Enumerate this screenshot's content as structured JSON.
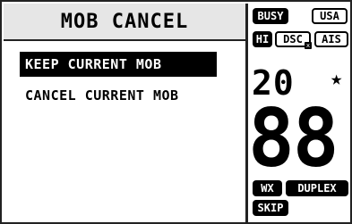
{
  "title": "MOB CANCEL",
  "menu": {
    "items": [
      {
        "label": "KEEP CURRENT MOB",
        "selected": true
      },
      {
        "label": "CANCEL CURRENT MOB",
        "selected": false
      }
    ]
  },
  "status": {
    "busy": "BUSY",
    "region": "USA",
    "power": "HI",
    "dsc": "DSC",
    "dsc_mark": "x",
    "ais": "AIS",
    "channel_small": "20",
    "star": "★",
    "channel_big": "88",
    "wx": "WX",
    "duplex": "DUPLEX",
    "skip": "SKIP"
  }
}
